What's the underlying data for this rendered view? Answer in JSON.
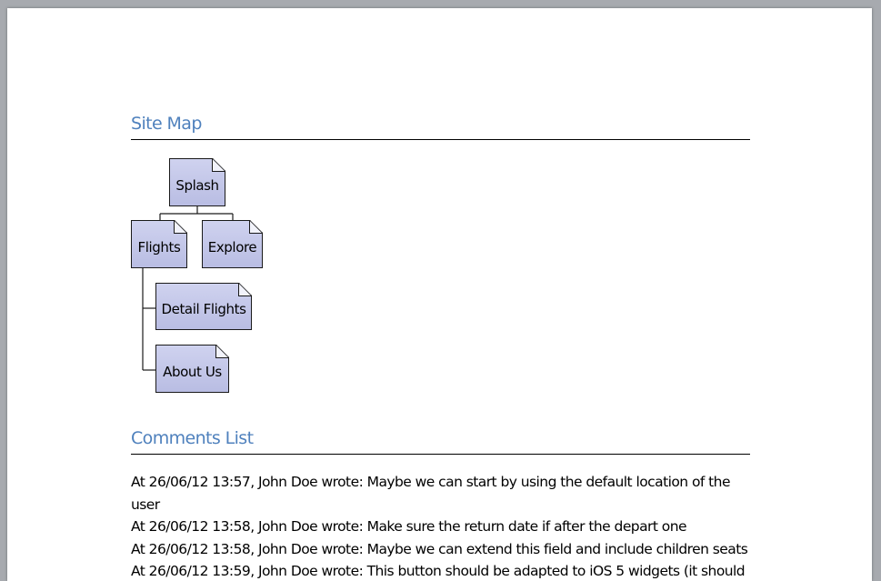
{
  "sitemap": {
    "heading": "Site Map",
    "nodes": {
      "splash": "Splash",
      "flights": "Flights",
      "explore": "Explore",
      "detail_flights": "Detail Flights",
      "about_us": "About Us"
    }
  },
  "comments": {
    "heading": "Comments List",
    "items": [
      "At 26/06/12 13:57, John Doe wrote: Maybe we can start by using the default location of the user",
      "At 26/06/12 13:58, John Doe wrote: Make sure the return date if after the depart one",
      "At 26/06/12 13:58, John Doe wrote: Maybe we can extend this field and include children seats",
      "At 26/06/12 13:59, John Doe wrote: This button should be adapted to iOS 5 widgets (it should"
    ]
  },
  "colors": {
    "heading": "#4f81bd",
    "node_fill": "#c4c8ea",
    "page_background": "#a7aaaf"
  }
}
